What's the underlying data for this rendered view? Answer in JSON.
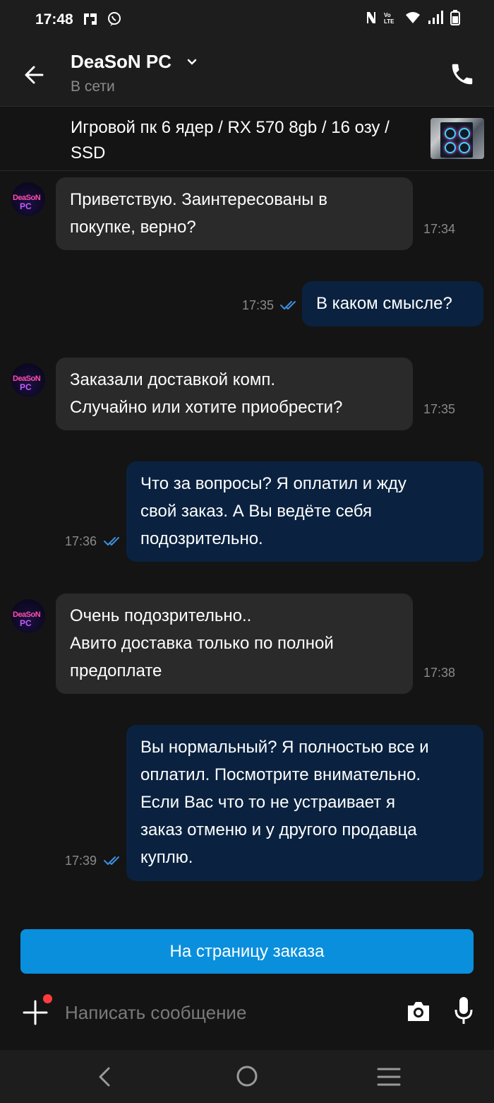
{
  "status_bar": {
    "time": "17:48"
  },
  "header": {
    "contact_name": "DeaSoN PC",
    "status": "В сети"
  },
  "item": {
    "title": "Игровой пк 6 ядер / RX 570 8gb / 16 озу / SSD"
  },
  "messages": [
    {
      "direction": "in",
      "text": "Приветствую. Заинтересованы в\nпокупке, верно?",
      "time": "17:34"
    },
    {
      "direction": "out",
      "text": "В каком смысле?",
      "time": "17:35",
      "read": true
    },
    {
      "direction": "in",
      "text": "Заказали доставкой комп.\nСлучайно или хотите приобрести?",
      "time": "17:35"
    },
    {
      "direction": "out",
      "text": "Что за вопросы? Я оплатил и жду\nсвой заказ. А Вы ведёте себя\nподозрительно.",
      "time": "17:36",
      "read": true
    },
    {
      "direction": "in",
      "text": "Очень подозрительно..\nАвито доставка только по полной\nпредоплате",
      "time": "17:38"
    },
    {
      "direction": "out",
      "text": "Вы нормальный? Я полностью все и\nоплатил. Посмотрите внимательно.\nЕсли Вас что то не устраивает я\nзаказ отменю и у другого продавца\nкуплю.",
      "time": "17:39",
      "read": true
    }
  ],
  "avatar": {
    "line1": "DeaSoN",
    "line2": "PC"
  },
  "order_button": {
    "label": "На страницу заказа"
  },
  "composer": {
    "placeholder": "Написать сообщение"
  },
  "colors": {
    "accent": "#0a8fdd",
    "outgoing_bubble": "#0a2240",
    "incoming_bubble": "#2a2a2a",
    "read_check": "#3d8fe0",
    "notification_dot": "#ff3b3b"
  },
  "icons": [
    "back-arrow-icon",
    "chevron-down-icon",
    "phone-icon",
    "plus-icon",
    "camera-icon",
    "microphone-icon",
    "double-check-icon"
  ]
}
